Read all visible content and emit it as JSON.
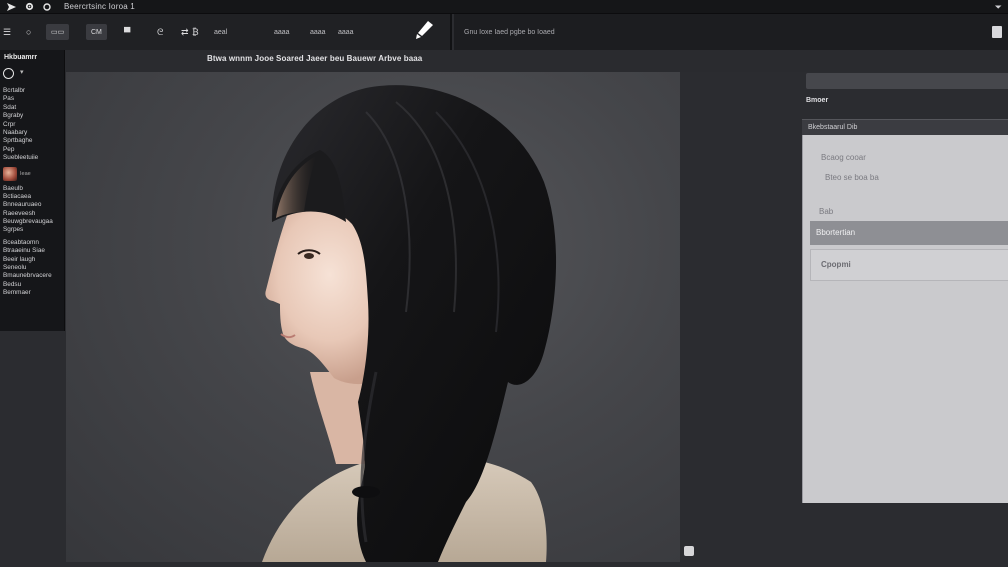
{
  "titlebar": {
    "title": "Beercrtsinc Ioroa 1",
    "icons": [
      "arrow-icon",
      "gear-icon",
      "circle-icon"
    ],
    "window_control": "⏷"
  },
  "toolbar": {
    "tools": [
      {
        "name": "menu-icon",
        "glyph": "☰"
      },
      {
        "name": "ellipse-tool-icon",
        "glyph": "○"
      },
      {
        "name": "rect-tool-button",
        "label": "▭▭"
      },
      {
        "name": "frame-tool-button",
        "label": "CM"
      },
      {
        "name": "layers-tool-icon",
        "glyph": "▀"
      },
      {
        "name": "lasso-tool-icon",
        "glyph": "ᘓ"
      },
      {
        "name": "transform-tool-icon",
        "glyph": "⇄"
      },
      {
        "name": "bracket-tool-icon",
        "glyph": "₿"
      }
    ],
    "text_tools": [
      "aeal",
      "aaaa",
      "aaaa",
      "aaaa"
    ],
    "brush": "brush-icon"
  },
  "toolbar_right": {
    "hint": "Gnu Ioxe Iaed pgbe bo Ioaed"
  },
  "docbar": {
    "menu_title": "Btwa wnnm Jooe Soared Jaeer beu Bauewr Arbve baaa"
  },
  "left_panel": {
    "title": "Hkbuamrr",
    "items": [
      "Bcrtalbr",
      "Pas",
      "Sdat",
      "Bgraby",
      "Crpr",
      "Naabary",
      "Sprtbaghe",
      "Pep",
      "Suebleetuiie"
    ],
    "swatch_caption": "Ieae",
    "items2": [
      "Baeulb",
      "Bctiacaea",
      "Bnneauruaeo",
      "Raeeveesh",
      "Beuwgbrevaugaa",
      "Sgrpes",
      "Bceabtaomn",
      "Btraaeinu Siae",
      "Beeir laugh",
      "Seneolu",
      "Bmaunebrvacere",
      "Bedsu",
      "Bemmaer"
    ]
  },
  "right_panel": {
    "label": "Bmoer",
    "header": "Bkebstaarul Dib",
    "rows": [
      "Bcaog cooar",
      "Bteo  se boa ba",
      "Bab"
    ],
    "selected": "Bbortertian",
    "box_label": "Cpopmi"
  },
  "colors": {
    "chrome_dark": "#151618",
    "toolbar": "#202124",
    "canvas_bg": "#3f4044",
    "panel_light": "#cacacd",
    "selection": "#8e8f94"
  }
}
